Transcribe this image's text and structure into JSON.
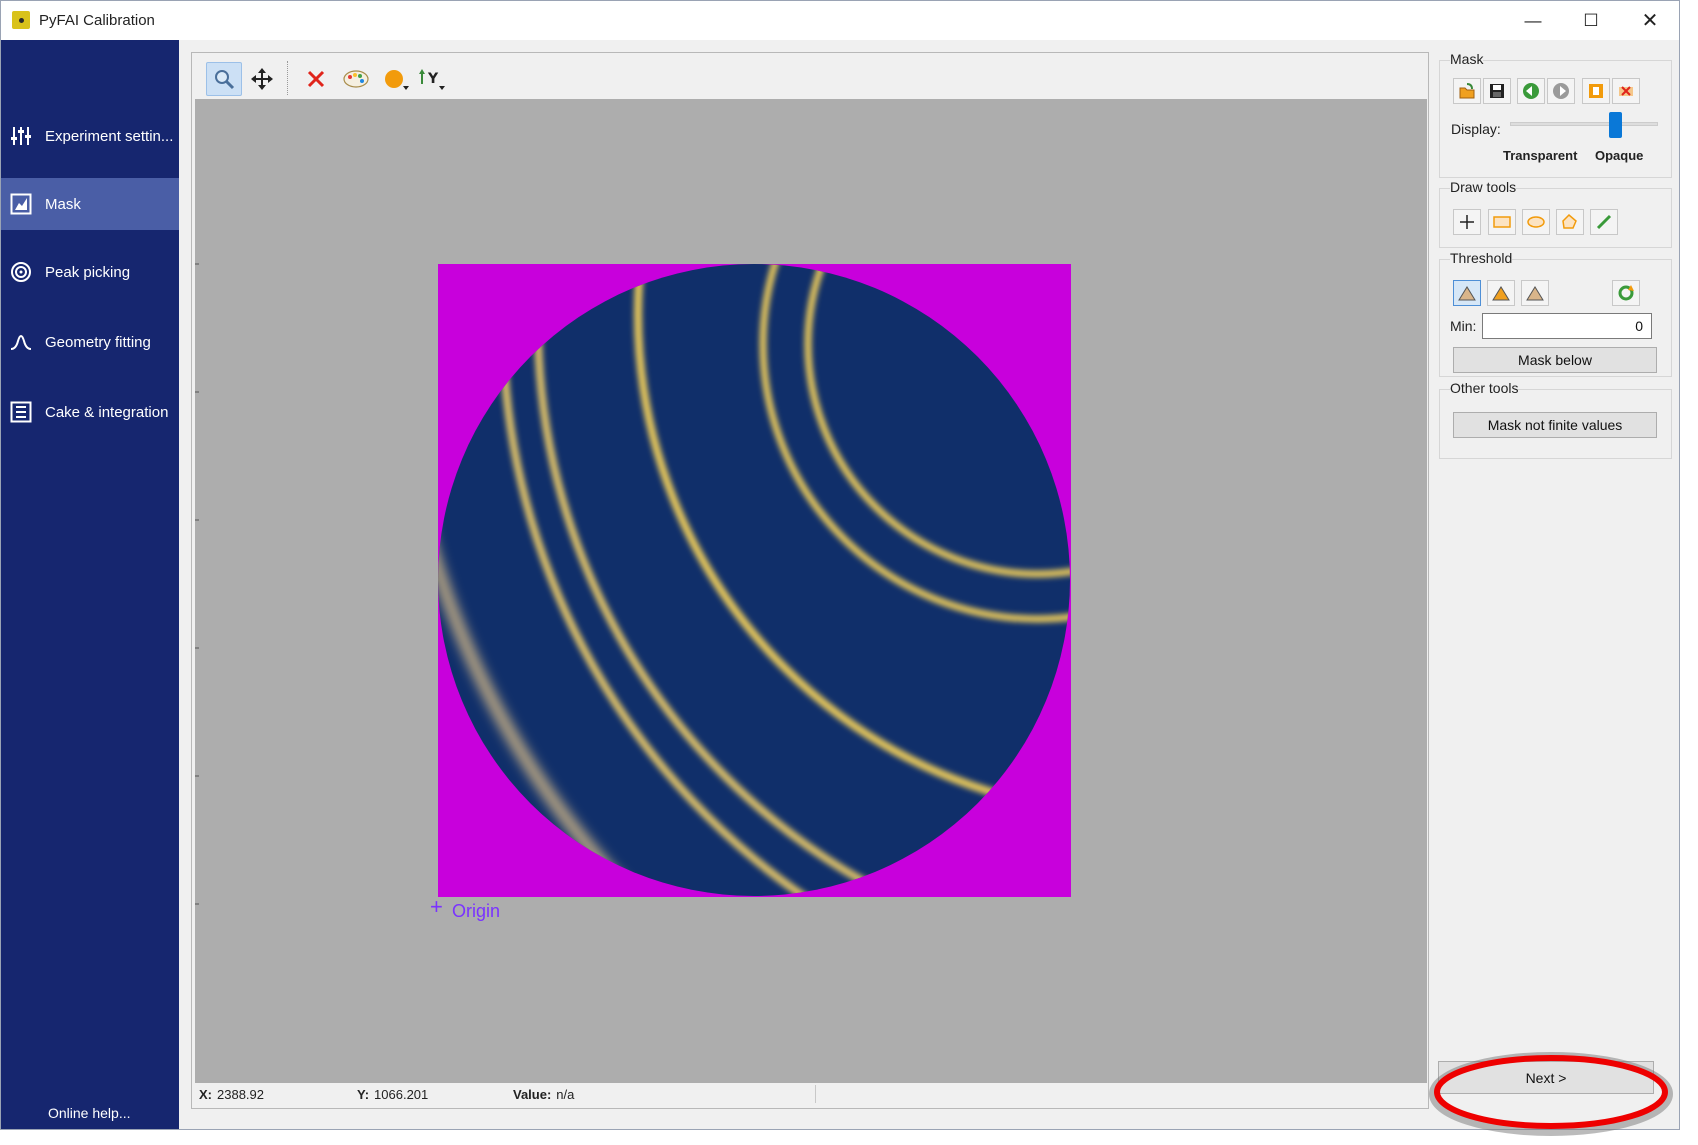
{
  "window": {
    "title": "PyFAI Calibration"
  },
  "sidebar": {
    "items": [
      {
        "label": "Experiment settin...",
        "icon": "sliders-icon"
      },
      {
        "label": "Mask",
        "icon": "mask-icon"
      },
      {
        "label": "Peak picking",
        "icon": "target-icon"
      },
      {
        "label": "Geometry fitting",
        "icon": "peak-icon"
      },
      {
        "label": "Cake & integration",
        "icon": "list-icon"
      }
    ],
    "active": "Mask",
    "online_help": "Online help..."
  },
  "plot": {
    "origin_label": "Origin",
    "status": {
      "x_label": "X:",
      "x_value": "2388.92",
      "y_label": "Y:",
      "y_value": "1066.201",
      "value_label": "Value:",
      "value": "n/a"
    },
    "colors": {
      "mask": "#c800dc",
      "background": "#adadad",
      "detector": "#102f6a",
      "ring": "#e8c85a"
    }
  },
  "mask_panel": {
    "title": "Mask",
    "display_label": "Display:",
    "transparent_label": "Transparent",
    "opaque_label": "Opaque",
    "opacity": 0.7
  },
  "draw_tools": {
    "title": "Draw tools"
  },
  "threshold": {
    "title": "Threshold",
    "min_label": "Min:",
    "min_value": "0",
    "mask_below_label": "Mask below"
  },
  "other_tools": {
    "title": "Other tools",
    "mask_not_finite_label": "Mask not finite values"
  },
  "navigation": {
    "next_label": "Next >"
  }
}
